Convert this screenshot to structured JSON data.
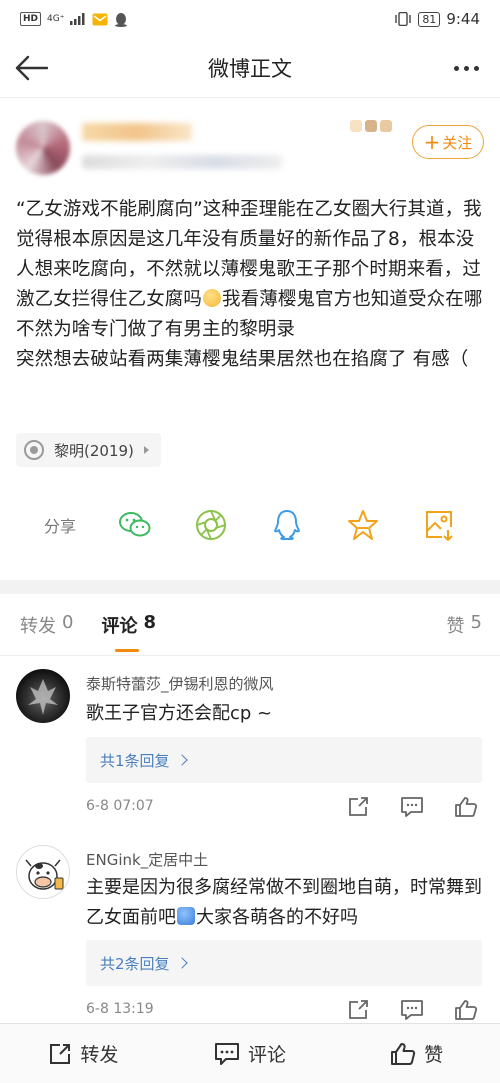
{
  "status_bar": {
    "hd": "HD",
    "network": "4G⁺",
    "battery": "81",
    "time": "9:44"
  },
  "nav": {
    "title": "微博正文"
  },
  "post": {
    "follow_label": "关注",
    "paragraphs": [
      "“乙女游戏不能刷腐向”这种歪理能在乙女圈大行其道，我觉得根本原因是这几年没有质量好的新作品了8，根本没人想来吃腐向，不然就以薄樱鬼歌王子那个时期来看，过激乙女拦得住乙女腐吗",
      "我看薄樱鬼官方也知道受众在哪不然为啥专门做了有男主的黎明录",
      "突然想去破站看两集薄樱鬼结果居然也在掐腐了 有感（"
    ],
    "topic": "黎明(2019)",
    "share_label": "分享"
  },
  "tabs": {
    "repost_label": "转发",
    "repost_count": "0",
    "comment_label": "评论",
    "comment_count": "8",
    "like_label": "赞",
    "like_count": "5"
  },
  "comments": [
    {
      "name": "泰斯特蕾莎_伊锡利恩的微风",
      "text": "歌王子官方还会配cp ~",
      "replies": "共1条回复",
      "time": "6-8 07:07"
    },
    {
      "name": "ENGink_定居中土",
      "text_before": "主要是因为很多腐经常做不到圈地自萌，时常舞到乙女面前吧",
      "text_after": "大家各萌各的不好吗",
      "replies": "共2条回复",
      "time": "6-8 13:19"
    }
  ],
  "bottom_bar": {
    "repost": "转发",
    "comment": "评论",
    "like": "赞"
  },
  "colors": {
    "accent": "#f08a10",
    "link": "#4a7fbf",
    "wechat": "#3dbb5e",
    "moments": "#8bc34a",
    "qq": "#3e9be5",
    "favorite": "#f2a21b"
  }
}
